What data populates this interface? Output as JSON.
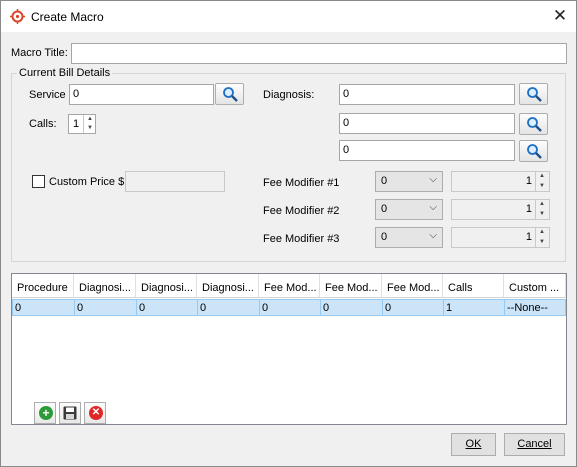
{
  "window": {
    "title": "Create Macro",
    "close_glyph": "✕",
    "icon": "target-icon"
  },
  "macro_title": {
    "label": "Macro Title:",
    "value": ""
  },
  "bill_group": {
    "title": "Current Bill Details"
  },
  "service": {
    "label": "Service",
    "value": "0"
  },
  "calls": {
    "label": "Calls:",
    "value": "1"
  },
  "diagnosis": {
    "label": "Diagnosis:",
    "values": [
      "0",
      "0",
      "0"
    ]
  },
  "custom_price": {
    "label": "Custom Price $",
    "checked": false,
    "value": ""
  },
  "fee_modifiers": [
    {
      "label": "Fee Modifier #1",
      "code": "0",
      "qty": "1"
    },
    {
      "label": "Fee Modifier #2",
      "code": "0",
      "qty": "1"
    },
    {
      "label": "Fee Modifier #3",
      "code": "0",
      "qty": "1"
    }
  ],
  "grid": {
    "columns": [
      "Procedure",
      "Diagnosi...",
      "Diagnosi...",
      "Diagnosi...",
      "Fee Mod...",
      "Fee Mod...",
      "Fee Mod...",
      "Calls",
      "Custom ..."
    ],
    "rows": [
      [
        "0",
        "0",
        "0",
        "0",
        "0",
        "0",
        "0",
        "1",
        "--None--"
      ]
    ]
  },
  "toolbar": {
    "add_icon": "plus-circle-icon",
    "save_icon": "floppy-disk-icon",
    "delete_icon": "x-circle-icon"
  },
  "buttons": {
    "ok": "OK",
    "cancel": "Cancel"
  },
  "colors": {
    "selection": "#cce4f7",
    "selection_border": "#99c9ef",
    "search_icon": "#1f6fc5",
    "add_green": "#2e9b3a",
    "delete_red": "#e02828",
    "app_icon": "#d9452b"
  }
}
